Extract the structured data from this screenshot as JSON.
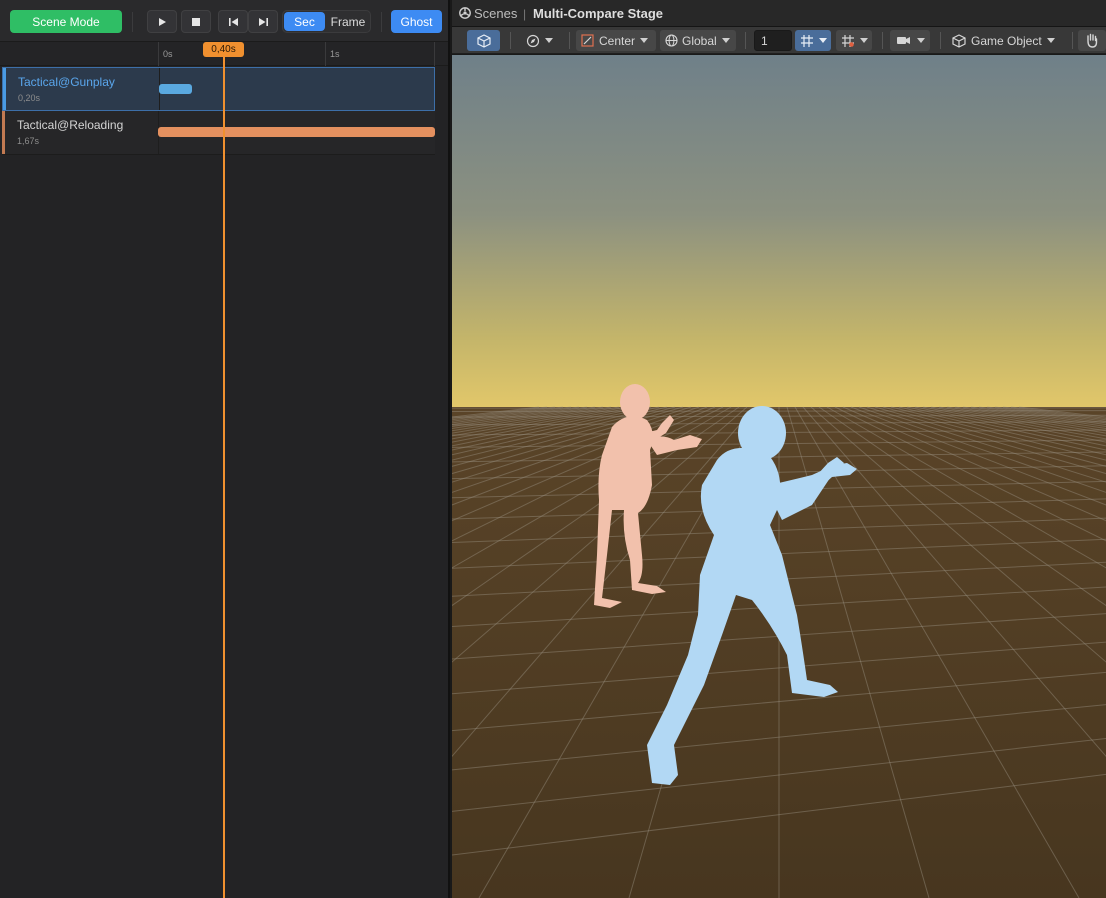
{
  "timeline": {
    "scene_mode_label": "Scene Mode",
    "play_icon": "play-icon",
    "stop_icon": "stop-icon",
    "prev_icon": "step-back-icon",
    "next_icon": "step-forward-icon",
    "units": {
      "sec_label": "Sec",
      "frame_label": "Frame",
      "selected": "Sec"
    },
    "ghost_label": "Ghost",
    "ruler": {
      "ticks": [
        "0s",
        "1s"
      ]
    },
    "playhead_label": "0,40s",
    "tracks": [
      {
        "name": "Tactical@Gunplay",
        "duration": "0,20s",
        "selected": true,
        "color": "#5aa9e0"
      },
      {
        "name": "Tactical@Reloading",
        "duration": "1,67s",
        "selected": false,
        "color": "#e4905f"
      }
    ],
    "colors": {
      "accent": "#3d8bf3",
      "scene_mode": "#2fbe65",
      "playhead": "#f0902f"
    }
  },
  "scene": {
    "breadcrumb_root": "Scenes",
    "breadcrumb_sep": "|",
    "stage_name": "Multi-Compare Stage",
    "toolbar": {
      "pivot_label": "Center",
      "space_label": "Global",
      "grid_size_value": "1",
      "game_object_label": "Game Object"
    },
    "characters": [
      {
        "name": "ghost-character",
        "color": "#f2c1ac"
      },
      {
        "name": "active-character",
        "color": "#b2d8f4"
      }
    ]
  }
}
